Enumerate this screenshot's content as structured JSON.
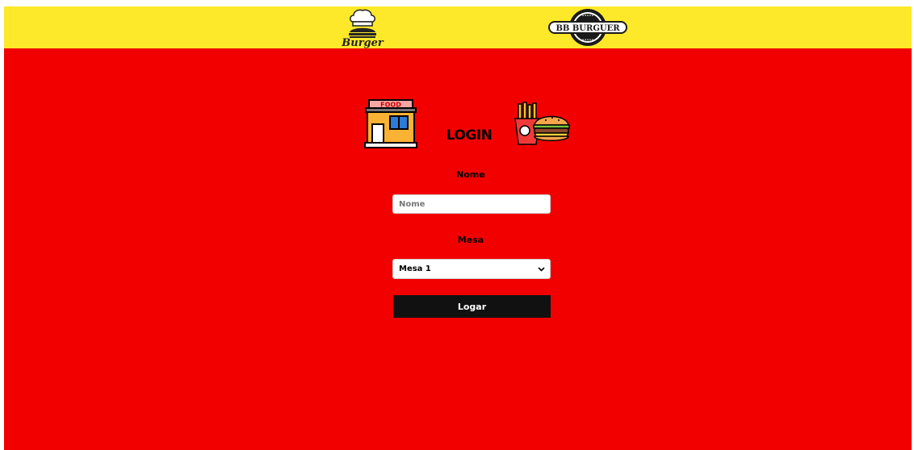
{
  "header": {
    "logos": [
      {
        "name": "burger-logo",
        "text": "Burger"
      },
      {
        "name": "bb-burguer-logo",
        "text": "BB BURGUER"
      }
    ]
  },
  "login": {
    "title": "LOGIN",
    "store_icon_text": "FOOD",
    "nome": {
      "label": "Nome",
      "placeholder": "Nome",
      "value": ""
    },
    "mesa": {
      "label": "Mesa",
      "selected": "Mesa 1",
      "options": [
        "Mesa 1"
      ]
    },
    "submit_label": "Logar"
  },
  "colors": {
    "topbar": "#fde82a",
    "background": "#f20000",
    "button": "#111111",
    "button_text": "#ffffff"
  }
}
